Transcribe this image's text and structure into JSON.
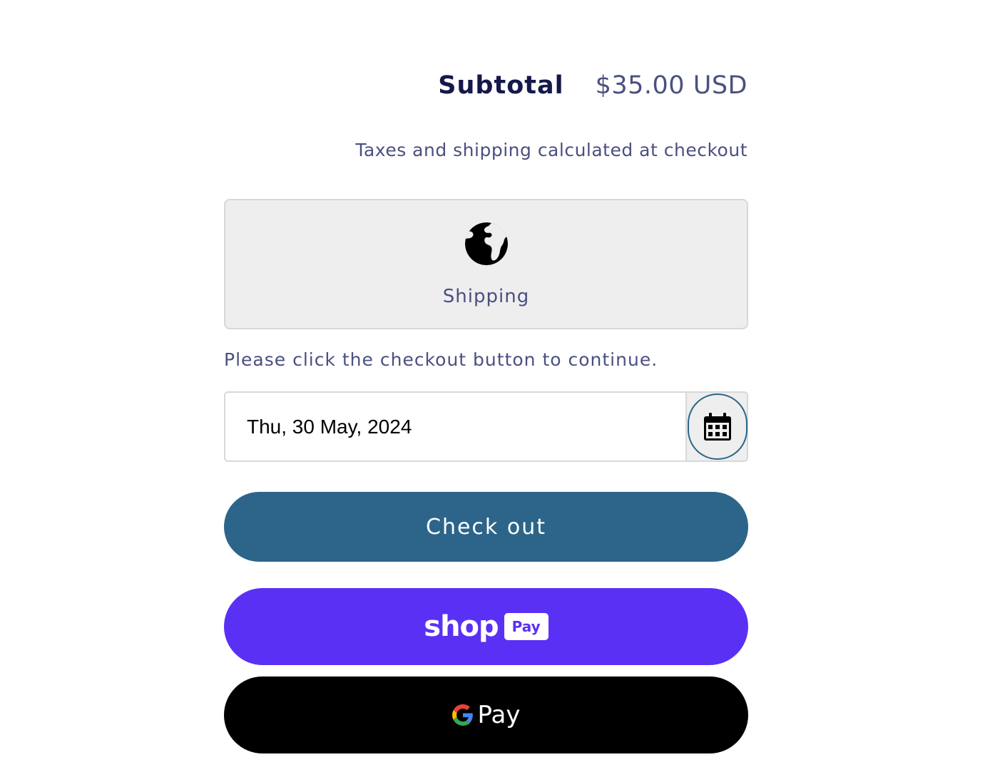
{
  "summary": {
    "subtotal_label": "Subtotal",
    "subtotal_value": "$35.00 USD",
    "tax_note": "Taxes and shipping calculated at checkout"
  },
  "shipping": {
    "icon": "globe-icon",
    "label": "Shipping"
  },
  "instruction": "Please click the checkout button to continue.",
  "delivery_date": {
    "value": "Thu, 30 May, 2024",
    "calendar_icon": "calendar-icon"
  },
  "checkout_button": {
    "label": "Check out"
  },
  "shop_pay": {
    "word": "shop",
    "badge": "Pay"
  },
  "google_pay": {
    "label": "Pay"
  },
  "colors": {
    "primary": "#2c6589",
    "shop_pay": "#5a31f4",
    "google_pay": "#000000",
    "heading": "#14184a",
    "text": "#4a5080"
  }
}
